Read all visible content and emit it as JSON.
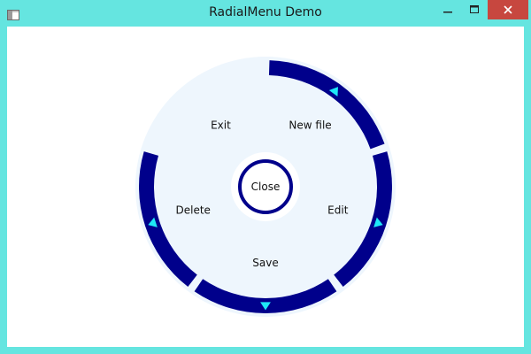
{
  "window": {
    "title": "RadialMenu Demo"
  },
  "menu": {
    "center_label": "Close",
    "items": [
      {
        "label": "New file",
        "has_submenu": true
      },
      {
        "label": "Edit",
        "has_submenu": true
      },
      {
        "label": "Save",
        "has_submenu": true
      },
      {
        "label": "Delete",
        "has_submenu": true
      },
      {
        "label": "Exit",
        "has_submenu": false
      }
    ]
  },
  "colors": {
    "titlebar": "#65e5e0",
    "ring": "#00008b",
    "item_fill": "#eef6fd",
    "arrow": "#1ee8f6",
    "close_button": "#c7473f"
  }
}
